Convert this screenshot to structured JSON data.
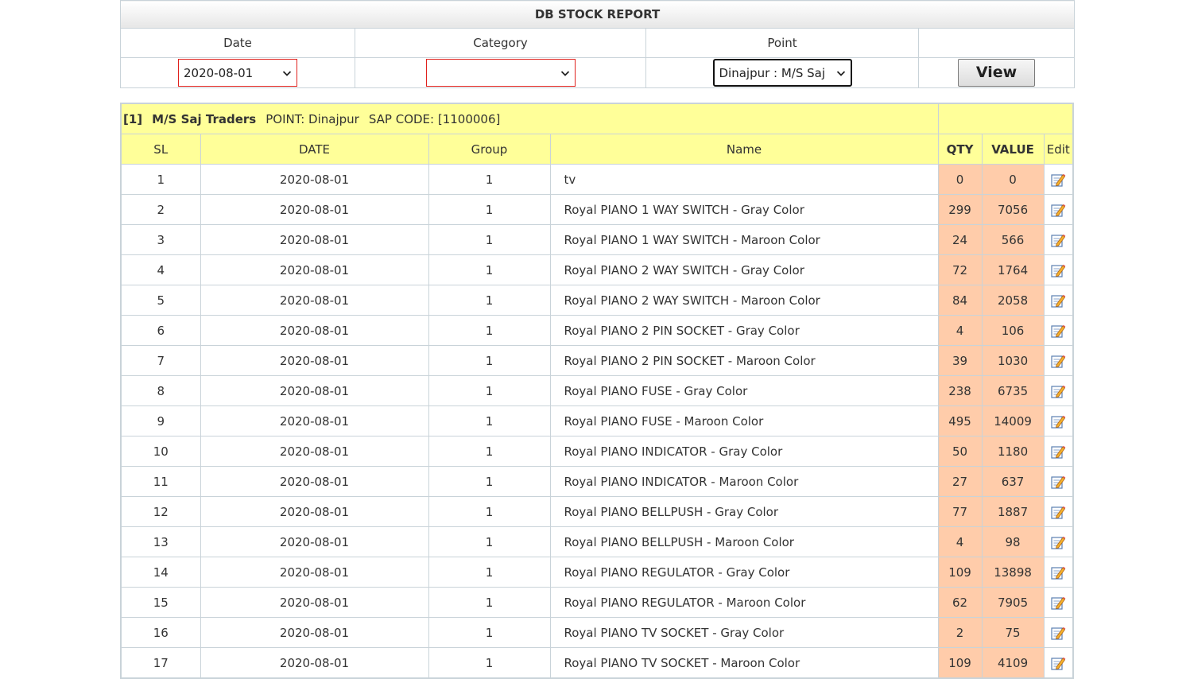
{
  "report": {
    "title": "DB STOCK REPORT",
    "labels": {
      "date": "Date",
      "category": "Category",
      "point": "Point"
    },
    "date_value": "2020-08-01",
    "category_value": "",
    "point_value": "Dinajpur : M/S Saj",
    "view_label": "View"
  },
  "dealer": {
    "index": "[1]",
    "name": "M/S Saj Traders",
    "point": "POINT: Dinajpur",
    "sap": "SAP CODE: [1100006]"
  },
  "table": {
    "headers": {
      "sl": "SL",
      "date": "DATE",
      "group": "Group",
      "name": "Name",
      "qty": "QTY",
      "value": "VALUE",
      "edit": "Edit"
    },
    "rows": [
      {
        "sl": "1",
        "date": "2020-08-01",
        "group": "1",
        "name": "tv",
        "qty": "0",
        "value": "0"
      },
      {
        "sl": "2",
        "date": "2020-08-01",
        "group": "1",
        "name": "Royal PIANO 1 WAY SWITCH - Gray Color",
        "qty": "299",
        "value": "7056"
      },
      {
        "sl": "3",
        "date": "2020-08-01",
        "group": "1",
        "name": "Royal PIANO 1 WAY SWITCH - Maroon Color",
        "qty": "24",
        "value": "566"
      },
      {
        "sl": "4",
        "date": "2020-08-01",
        "group": "1",
        "name": "Royal PIANO 2 WAY SWITCH - Gray Color",
        "qty": "72",
        "value": "1764"
      },
      {
        "sl": "5",
        "date": "2020-08-01",
        "group": "1",
        "name": "Royal PIANO 2 WAY SWITCH - Maroon Color",
        "qty": "84",
        "value": "2058"
      },
      {
        "sl": "6",
        "date": "2020-08-01",
        "group": "1",
        "name": "Royal PIANO 2 PIN SOCKET - Gray Color",
        "qty": "4",
        "value": "106"
      },
      {
        "sl": "7",
        "date": "2020-08-01",
        "group": "1",
        "name": "Royal PIANO 2 PIN SOCKET - Maroon Color",
        "qty": "39",
        "value": "1030"
      },
      {
        "sl": "8",
        "date": "2020-08-01",
        "group": "1",
        "name": "Royal PIANO FUSE - Gray Color",
        "qty": "238",
        "value": "6735"
      },
      {
        "sl": "9",
        "date": "2020-08-01",
        "group": "1",
        "name": "Royal PIANO FUSE - Maroon Color",
        "qty": "495",
        "value": "14009"
      },
      {
        "sl": "10",
        "date": "2020-08-01",
        "group": "1",
        "name": "Royal PIANO INDICATOR - Gray Color",
        "qty": "50",
        "value": "1180"
      },
      {
        "sl": "11",
        "date": "2020-08-01",
        "group": "1",
        "name": "Royal PIANO INDICATOR - Maroon Color",
        "qty": "27",
        "value": "637"
      },
      {
        "sl": "12",
        "date": "2020-08-01",
        "group": "1",
        "name": "Royal PIANO BELLPUSH - Gray Color",
        "qty": "77",
        "value": "1887"
      },
      {
        "sl": "13",
        "date": "2020-08-01",
        "group": "1",
        "name": "Royal PIANO BELLPUSH - Maroon Color",
        "qty": "4",
        "value": "98"
      },
      {
        "sl": "14",
        "date": "2020-08-01",
        "group": "1",
        "name": "Royal PIANO REGULATOR - Gray Color",
        "qty": "109",
        "value": "13898"
      },
      {
        "sl": "15",
        "date": "2020-08-01",
        "group": "1",
        "name": "Royal PIANO REGULATOR - Maroon Color",
        "qty": "62",
        "value": "7905"
      },
      {
        "sl": "16",
        "date": "2020-08-01",
        "group": "1",
        "name": "Royal PIANO TV SOCKET - Gray Color",
        "qty": "2",
        "value": "75"
      },
      {
        "sl": "17",
        "date": "2020-08-01",
        "group": "1",
        "name": "Royal PIANO TV SOCKET - Maroon Color",
        "qty": "109",
        "value": "4109"
      }
    ]
  },
  "icons": {
    "edit": "edit-pencil-icon",
    "dropdown": "chevron-down-icon"
  },
  "colors": {
    "header_yellow": "#ffff99",
    "number_cell": "#ffccaa",
    "invalid_border": "#e0221e"
  }
}
